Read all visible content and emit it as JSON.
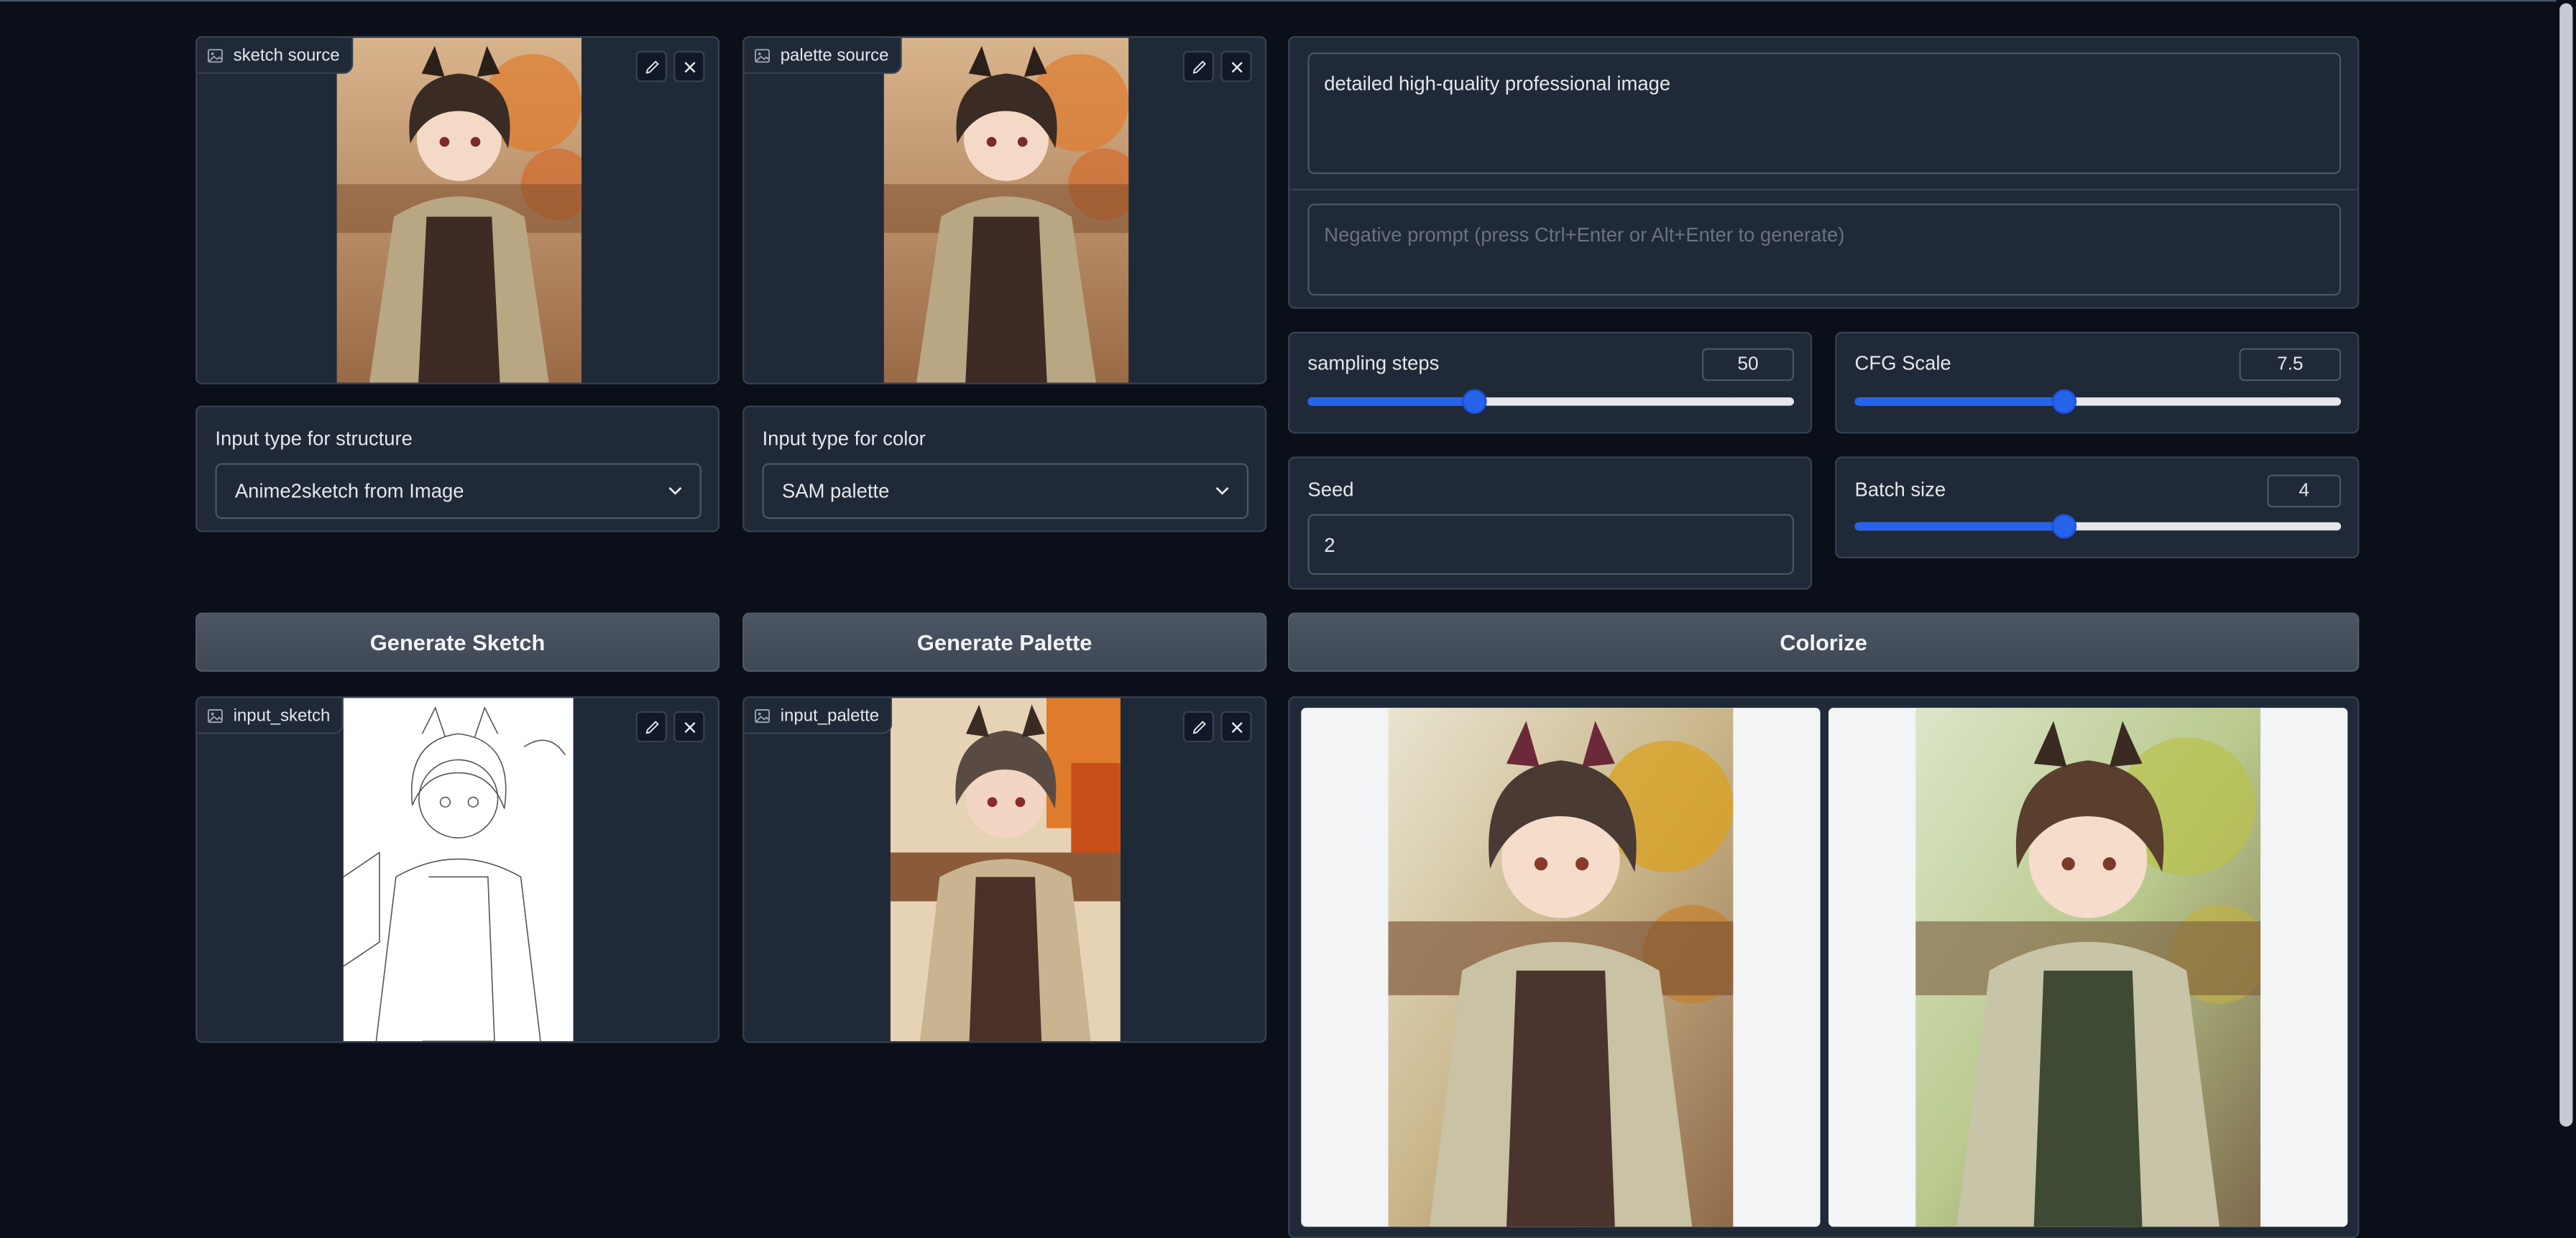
{
  "image_panels": {
    "sketch_source": {
      "label": "sketch source"
    },
    "palette_source": {
      "label": "palette source"
    },
    "input_sketch": {
      "label": "input_sketch"
    },
    "input_palette": {
      "label": "input_palette"
    }
  },
  "structure_input": {
    "label": "Input type for structure",
    "selected": "Anime2sketch from Image"
  },
  "color_input": {
    "label": "Input type for color",
    "selected": "SAM palette"
  },
  "prompt": {
    "value": "detailed high-quality professional image",
    "negative_placeholder": "Negative prompt (press Ctrl+Enter or Alt+Enter to generate)"
  },
  "sampling_steps": {
    "label": "sampling steps",
    "value": "50",
    "fraction": 0.34
  },
  "cfg_scale": {
    "label": "CFG Scale",
    "value": "7.5",
    "fraction": 0.43
  },
  "seed": {
    "label": "Seed",
    "value": "2"
  },
  "batch_size": {
    "label": "Batch size",
    "value": "4",
    "fraction": 0.43
  },
  "buttons": {
    "generate_sketch": "Generate Sketch",
    "generate_palette": "Generate Palette",
    "colorize": "Colorize"
  },
  "icons": [
    "image-icon",
    "edit-icon",
    "close-icon",
    "chevron-down-icon"
  ],
  "colors": {
    "accent": "#2563eb",
    "panel": "#1f2937",
    "background": "#0b0f19",
    "button": "#4b5563"
  }
}
